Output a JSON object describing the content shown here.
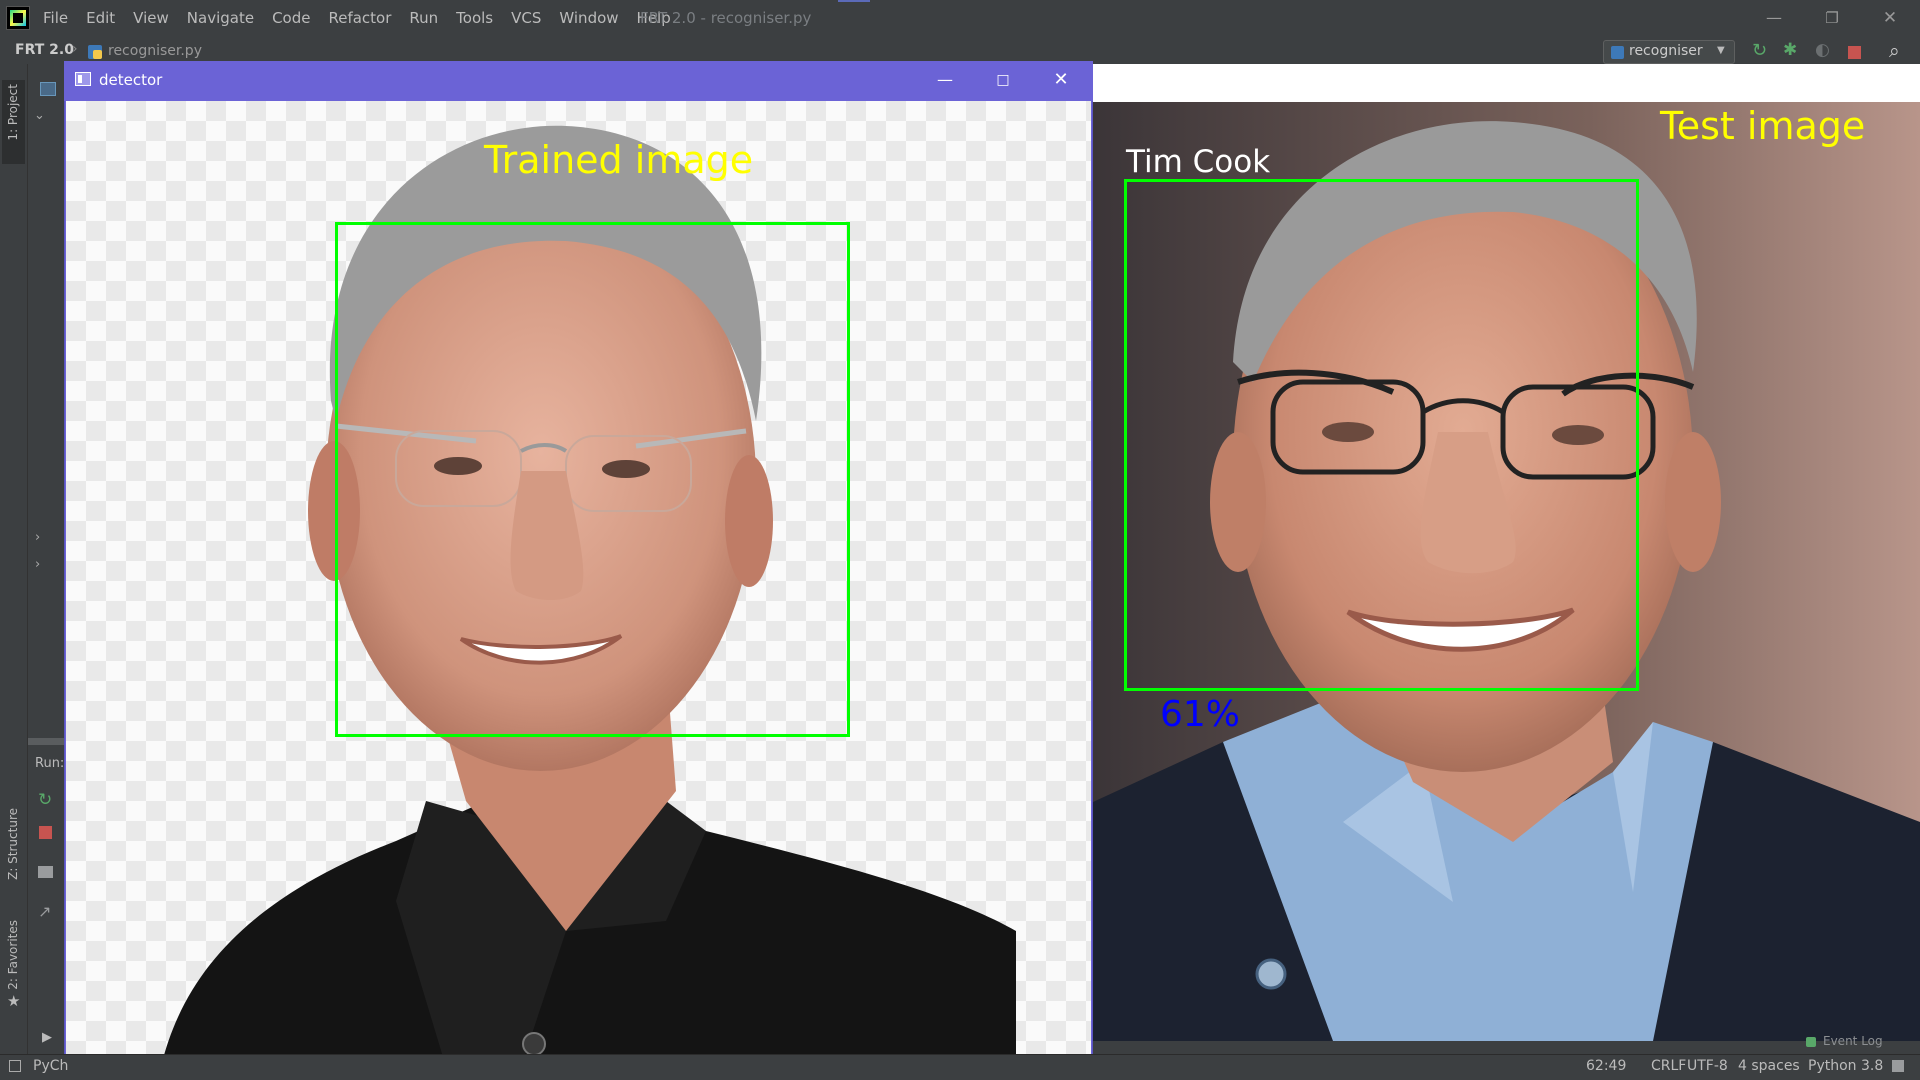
{
  "menubar": {
    "items": [
      "File",
      "Edit",
      "View",
      "Navigate",
      "Code",
      "Refactor",
      "Run",
      "Tools",
      "VCS",
      "Window",
      "Help"
    ],
    "window_title": "FRT 2.0 - recogniser.py"
  },
  "navbar": {
    "project": "FRT 2.0",
    "file": "recogniser.py"
  },
  "toolbar": {
    "run_config": "recogniser"
  },
  "side_tabs": {
    "project": "1: Project",
    "structure": "Z: Structure",
    "favorites": "2: Favorites"
  },
  "run_panel": {
    "label": "Run:"
  },
  "detector_window": {
    "title": "detector",
    "trained_label": "Trained image",
    "trained_label_color": "#ffff00",
    "box_color": "#00ff00"
  },
  "test_window": {
    "test_label": "Test image",
    "test_label_color": "#ffff00",
    "person_name": "Tim Cook",
    "name_color": "#ffffff",
    "confidence": "61%",
    "confidence_color": "#0000ff",
    "box_color": "#00ff00"
  },
  "statusbar": {
    "app": "PyCh",
    "position": "62:49",
    "line_ending": "CRLF",
    "encoding": "UTF-8",
    "indent": "4 spaces",
    "interpreter": "Python 3.8",
    "event_log": "Event Log"
  }
}
